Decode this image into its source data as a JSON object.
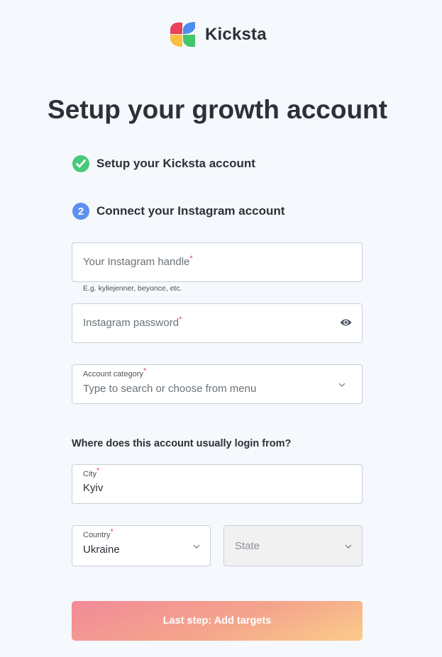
{
  "brand": {
    "name": "Kicksta"
  },
  "page": {
    "title": "Setup your growth account"
  },
  "steps": [
    {
      "badge": "✓",
      "label": "Setup your Kicksta account",
      "status": "done"
    },
    {
      "badge": "2",
      "label": "Connect your Instagram account",
      "status": "current"
    }
  ],
  "form": {
    "handle": {
      "placeholder": "Your Instagram handle",
      "required_mark": "*",
      "hint": "E.g. kyliejenner, beyonce, etc."
    },
    "password": {
      "placeholder": "Instagram password",
      "required_mark": "*",
      "toggle_icon": "eye-icon"
    },
    "category": {
      "label": "Account category",
      "required_mark": "*",
      "placeholder": "Type to search or choose from menu"
    },
    "location_question": "Where does this account usually login from?",
    "city": {
      "label": "City",
      "required_mark": "*",
      "value": "Kyiv"
    },
    "country": {
      "label": "Country",
      "required_mark": "*",
      "value": "Ukraine"
    },
    "state": {
      "placeholder": "State"
    },
    "submit_label": "Last step: Add targets"
  },
  "colors": {
    "background": "#f5f8fc",
    "step_done": "#47c97a",
    "step_current": "#5c8fef",
    "required": "#e0475a",
    "cta_gradient_start": "#f28a98",
    "cta_gradient_end": "#fbcc8a"
  }
}
